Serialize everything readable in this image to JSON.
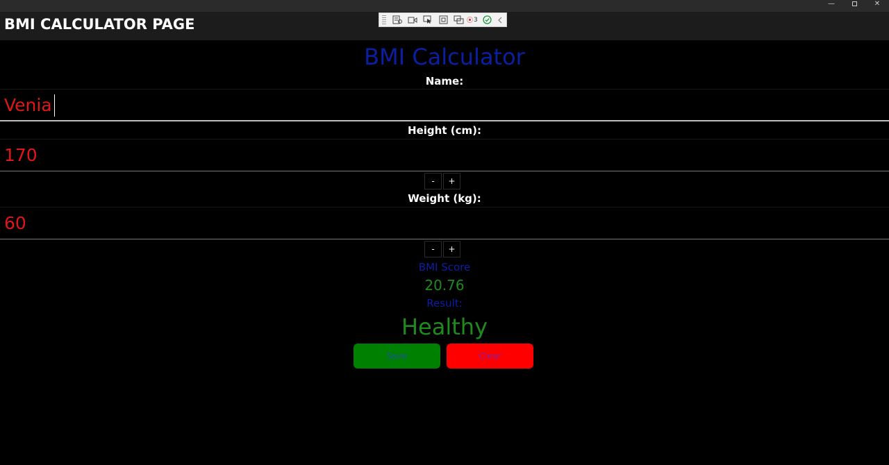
{
  "window": {
    "title": "BMI CALCULATOR PAGE",
    "controls": {
      "minimize": "—",
      "restore": "",
      "close": "✕"
    }
  },
  "debug_toolbar": {
    "icons": [
      "live-visual-tree-icon",
      "video-icon",
      "select-element-icon",
      "display-layout-adorners-icon",
      "track-focused-element-icon",
      "binding-failures-icon",
      "hot-reload-check-icon",
      "collapse-chevron-icon"
    ],
    "binding_failures_count": "3"
  },
  "form": {
    "heading": "BMI Calculator",
    "name_label": "Name:",
    "name_value": "Venia",
    "height_label": "Height (cm):",
    "height_value": "170",
    "weight_label": "Weight (kg):",
    "weight_value": "60",
    "decrement_label": "-",
    "increment_label": "+"
  },
  "output": {
    "score_label": "BMI Score",
    "score_value": "20.76",
    "result_label": "Result:",
    "result_value": "Healthy"
  },
  "actions": {
    "save_label": "Save",
    "clear_label": "Clear"
  },
  "colors": {
    "background": "#000000",
    "heading": "#0b1fa3",
    "input_text": "#e01717",
    "result_green": "#1f8a1f",
    "save_button": "#008000",
    "clear_button": "#ff0000"
  }
}
